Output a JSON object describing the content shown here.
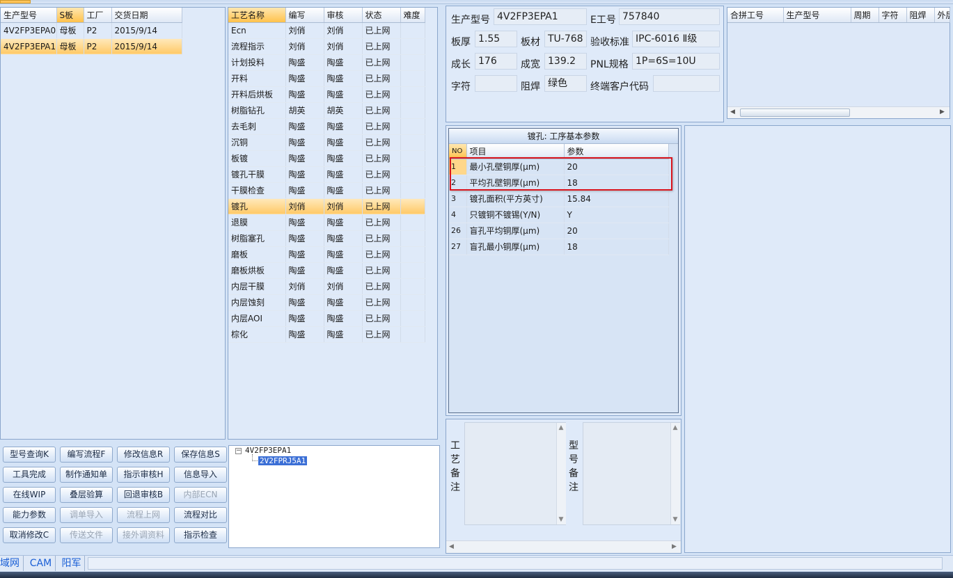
{
  "models_table": {
    "headers": [
      "生产型号",
      "S板",
      "工厂",
      "交货日期"
    ],
    "rows": [
      [
        "4V2FP3EPA0",
        "母板",
        "P2",
        "2015/9/14"
      ],
      [
        "4V2FP3EPA1",
        "母板",
        "P2",
        "2015/9/14"
      ]
    ]
  },
  "process_table": {
    "headers": [
      "工艺名称",
      "编写",
      "审核",
      "状态",
      "难度"
    ],
    "rows": [
      [
        "Ecn",
        "刘俏",
        "刘俏",
        "已上网",
        ""
      ],
      [
        "流程指示",
        "刘俏",
        "刘俏",
        "已上网",
        ""
      ],
      [
        "计划投料",
        "陶盛",
        "陶盛",
        "已上网",
        ""
      ],
      [
        "开料",
        "陶盛",
        "陶盛",
        "已上网",
        ""
      ],
      [
        "开料后烘板",
        "陶盛",
        "陶盛",
        "已上网",
        ""
      ],
      [
        "树脂钻孔",
        "胡英",
        "胡英",
        "已上网",
        ""
      ],
      [
        "去毛刺",
        "陶盛",
        "陶盛",
        "已上网",
        ""
      ],
      [
        "沉铜",
        "陶盛",
        "陶盛",
        "已上网",
        ""
      ],
      [
        "板镀",
        "陶盛",
        "陶盛",
        "已上网",
        ""
      ],
      [
        "镀孔干膜",
        "陶盛",
        "陶盛",
        "已上网",
        ""
      ],
      [
        "干膜检查",
        "陶盛",
        "陶盛",
        "已上网",
        ""
      ],
      [
        "镀孔",
        "刘俏",
        "刘俏",
        "已上网",
        ""
      ],
      [
        "退膜",
        "陶盛",
        "陶盛",
        "已上网",
        ""
      ],
      [
        "树脂塞孔",
        "陶盛",
        "陶盛",
        "已上网",
        ""
      ],
      [
        "磨板",
        "陶盛",
        "陶盛",
        "已上网",
        ""
      ],
      [
        "磨板烘板",
        "陶盛",
        "陶盛",
        "已上网",
        ""
      ],
      [
        "内层干膜",
        "刘俏",
        "刘俏",
        "已上网",
        ""
      ],
      [
        "内层蚀刻",
        "陶盛",
        "陶盛",
        "已上网",
        ""
      ],
      [
        "内层AOI",
        "陶盛",
        "陶盛",
        "已上网",
        ""
      ],
      [
        "棕化",
        "陶盛",
        "陶盛",
        "已上网",
        ""
      ]
    ]
  },
  "info": {
    "model_label": "生产型号",
    "model_value": "4V2FP3EPA1",
    "eno_label": "E工号",
    "eno_value": "757840",
    "thickness_label": "板厚",
    "thickness_value": "1.55",
    "material_label": "板材",
    "material_value": "TU-768",
    "standard_label": "验收标准",
    "standard_value": "IPC-6016 Ⅱ级",
    "length_label": "成长",
    "length_value": "176",
    "width_label": "成宽",
    "width_value": "139.2",
    "pnl_label": "PNL规格",
    "pnl_value": "1P=6S=10U",
    "char_label": "字符",
    "char_value": "",
    "mask_label": "阻焊",
    "mask_value": "绿色",
    "customer_label": "终端客户代码",
    "customer_value": ""
  },
  "merge_table": {
    "headers": [
      "合拼工号",
      "生产型号",
      "周期",
      "字符",
      "阻焊",
      "外层"
    ]
  },
  "params": {
    "title": "镀孔: 工序基本参数",
    "headers": [
      "NO",
      "项目",
      "参数"
    ],
    "rows": [
      [
        "1",
        "最小孔壁铜厚(μm)",
        "20"
      ],
      [
        "2",
        "平均孔壁铜厚(μm)",
        "18"
      ],
      [
        "3",
        "镀孔面积(平方英寸)",
        "15.84"
      ],
      [
        "4",
        "只镀铜不镀锡(Y/N)",
        "Y"
      ],
      [
        "26",
        "盲孔平均铜厚(μm)",
        "20"
      ],
      [
        "27",
        "盲孔最小铜厚(μm)",
        "18"
      ]
    ]
  },
  "remarks": {
    "process_label": "工艺备注",
    "model_label": "型号备注"
  },
  "tree": {
    "root": "4V2FP3EPA1",
    "child": "2V2FPRJ5A1"
  },
  "buttons": [
    [
      "型号查询K",
      "编写流程F",
      "修改信息R",
      "保存信息S"
    ],
    [
      "工具完成",
      "制作通知单",
      "指示审核H",
      "信息导入"
    ],
    [
      "在线WIP",
      "叠层验算",
      "回退审核B",
      "内部ECN"
    ],
    [
      "能力参数",
      "调单导入",
      "流程上网",
      "流程对比"
    ],
    [
      "取消修改C",
      "传送文件",
      "接外调资料",
      "指示检查"
    ]
  ],
  "disabled_buttons": [
    "内部ECN",
    "调单导入",
    "流程上网",
    "传送文件",
    "接外调资料"
  ],
  "status_bar": {
    "items": [
      "域网",
      "CAM",
      "阳军"
    ]
  },
  "colors": {
    "background": "#d4e3f6",
    "selection": "#ffc967",
    "highlight_box": "#d9141d",
    "status_text": "#1a5fd6"
  }
}
